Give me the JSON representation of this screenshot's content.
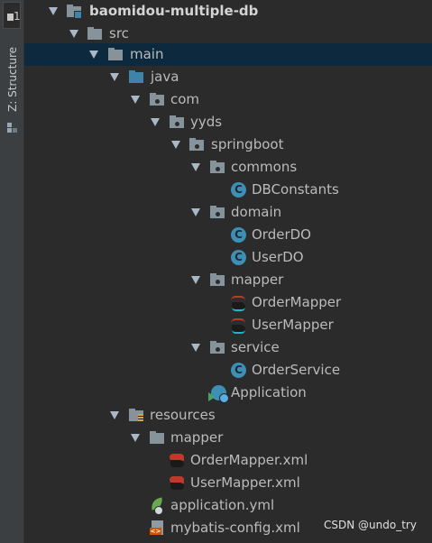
{
  "sidebar": {
    "project_number": "1",
    "structure_label": "Z: Structure"
  },
  "tree": {
    "items": [
      {
        "label": "baomidou-multiple-db",
        "icon": "module-folder-icon"
      },
      {
        "label": "src",
        "icon": "folder-icon"
      },
      {
        "label": "main",
        "icon": "folder-icon"
      },
      {
        "label": "java",
        "icon": "source-root-folder-icon"
      },
      {
        "label": "com",
        "icon": "package-icon"
      },
      {
        "label": "yyds",
        "icon": "package-icon"
      },
      {
        "label": "springboot",
        "icon": "package-icon"
      },
      {
        "label": "commons",
        "icon": "package-icon"
      },
      {
        "label": "DBConstants",
        "icon": "class-icon"
      },
      {
        "label": "domain",
        "icon": "package-icon"
      },
      {
        "label": "OrderDO",
        "icon": "class-icon"
      },
      {
        "label": "UserDO",
        "icon": "class-icon"
      },
      {
        "label": "mapper",
        "icon": "package-icon"
      },
      {
        "label": "OrderMapper",
        "icon": "mybatis-mapper-icon"
      },
      {
        "label": "UserMapper",
        "icon": "mybatis-mapper-icon"
      },
      {
        "label": "service",
        "icon": "package-icon"
      },
      {
        "label": "OrderService",
        "icon": "class-icon"
      },
      {
        "label": "Application",
        "icon": "spring-boot-application-icon"
      },
      {
        "label": "resources",
        "icon": "resources-folder-icon"
      },
      {
        "label": "mapper",
        "icon": "folder-icon"
      },
      {
        "label": "OrderMapper.xml",
        "icon": "mybatis-xml-icon"
      },
      {
        "label": "UserMapper.xml",
        "icon": "mybatis-xml-icon"
      },
      {
        "label": "application.yml",
        "icon": "spring-yml-icon"
      },
      {
        "label": "mybatis-config.xml",
        "icon": "xml-config-icon"
      }
    ],
    "selected": "main",
    "class_glyph": "C"
  },
  "watermark": "CSDN @undo_try",
  "colors": {
    "background": "#2b2b2b",
    "selection": "#0d293e",
    "text": "#bbbbbb",
    "class_icon": "#3d8fb5",
    "source_folder": "#3d84a8"
  }
}
